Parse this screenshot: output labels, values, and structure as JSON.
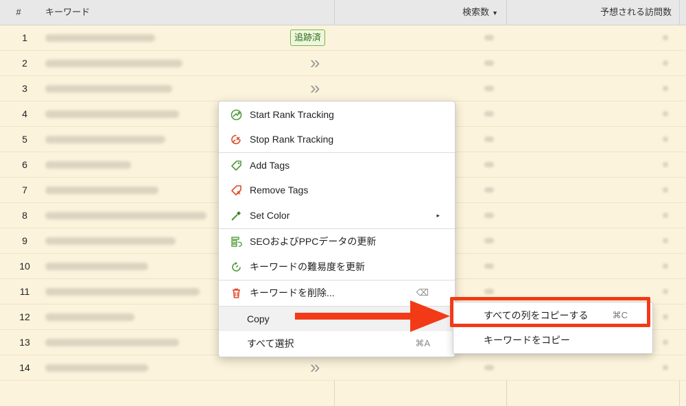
{
  "header": {
    "num": "#",
    "keyword": "キーワード",
    "search_volume": "検索数",
    "expected_visits": "予想される訪問数"
  },
  "rows": [
    {
      "num": "1",
      "badge": "追跡済"
    },
    {
      "num": "2"
    },
    {
      "num": "3"
    },
    {
      "num": "4"
    },
    {
      "num": "5"
    },
    {
      "num": "6"
    },
    {
      "num": "7"
    },
    {
      "num": "8"
    },
    {
      "num": "9"
    },
    {
      "num": "10"
    },
    {
      "num": "11"
    },
    {
      "num": "12"
    },
    {
      "num": "13"
    },
    {
      "num": "14"
    }
  ],
  "menu": {
    "start_rank": "Start Rank Tracking",
    "stop_rank": "Stop Rank Tracking",
    "add_tags": "Add Tags",
    "remove_tags": "Remove Tags",
    "set_color": "Set Color",
    "update_seo_ppc": "SEOおよびPPCデータの更新",
    "update_difficulty": "キーワードの難易度を更新",
    "delete_keyword": "キーワードを削除...",
    "delete_shortcut": "⌫",
    "copy": "Copy",
    "select_all": "すべて選択",
    "select_all_shortcut": "⌘A",
    "submenu_arrow": "▸"
  },
  "submenu": {
    "copy_all_columns": "すべての列をコピーする",
    "copy_all_shortcut": "⌘C",
    "copy_keyword": "キーワードをコピー"
  },
  "colors": {
    "row_bg": "#fcf3dc",
    "header_bg": "#e8e8e8",
    "highlight": "#f23a17",
    "tracked_green": "#7ab24a"
  }
}
